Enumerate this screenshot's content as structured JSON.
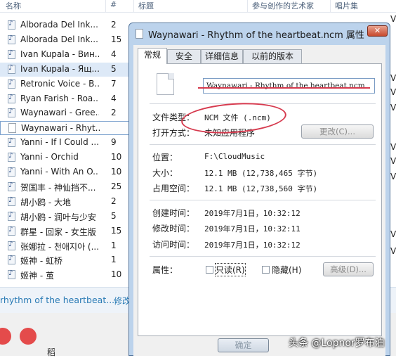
{
  "explorer": {
    "columns": {
      "name": "名称",
      "number": "#",
      "title": "标题",
      "artists": "参与创作的艺术家",
      "album": "唱片集"
    },
    "rows": [
      {
        "name": "Alborada Del Ink...",
        "num": "2"
      },
      {
        "name": "Alborada Del Ink...",
        "num": "15"
      },
      {
        "name": "Ivan Kupala - Вин...",
        "num": "4"
      },
      {
        "name": "Ivan Kupala - Ящ...",
        "num": "5"
      },
      {
        "name": "Retronic Voice - B...",
        "num": "7"
      },
      {
        "name": "Ryan Farish - Roa...",
        "num": "4"
      },
      {
        "name": "Waynawari - Gree...",
        "num": "2"
      },
      {
        "name": "Waynawari - Rhyt...",
        "num": ""
      },
      {
        "name": "Yanni - If I Could ...",
        "num": "9"
      },
      {
        "name": "Yanni - Orchid",
        "num": "10"
      },
      {
        "name": "Yanni - With An O...",
        "num": "10"
      },
      {
        "name": "贺国丰 - 神仙挡不...",
        "num": "25"
      },
      {
        "name": "胡小鸥 - 大地",
        "num": "2"
      },
      {
        "name": "胡小鸥 - 润叶与少安",
        "num": "5"
      },
      {
        "name": "群星 - 回家 - 女生版",
        "num": "15"
      },
      {
        "name": "张娜拉 - 천애지아 (...",
        "num": "1"
      },
      {
        "name": "姬神 - 虹桥",
        "num": "1"
      },
      {
        "name": "姬神 - 茧",
        "num": "10"
      }
    ],
    "right_edge": [
      "V",
      "V",
      "V",
      "V",
      "V",
      "V",
      "V",
      "V",
      "V"
    ],
    "details": {
      "title_text": "rhythm of the heartbeat....",
      "modify_text": "修改"
    },
    "bottom_char": "稻"
  },
  "dialog": {
    "title": "Waynawari - Rhythm of the heartbeat.ncm 属性",
    "close_glyph": "✕",
    "tabs": [
      "常规",
      "安全",
      "详细信息",
      "以前的版本"
    ],
    "filename": "Waynawari - Rhythm of the heartbeat.ncm",
    "file_type_label": "文件类型：",
    "file_type_value": "NCM 文件 (.ncm)",
    "open_with_label": "打开方式：",
    "open_with_value": "未知应用程序",
    "change_button": "更改(C)...",
    "location_label": "位置：",
    "location_value": "F:\\CloudMusic",
    "size_label": "大小：",
    "size_value": "12.1 MB (12,738,465 字节)",
    "size_on_disk_label": "占用空间：",
    "size_on_disk_value": "12.1 MB (12,738,560 字节)",
    "created_label": "创建时间：",
    "created_value": "2019年7月1日，10:32:12",
    "modified_label": "修改时间：",
    "modified_value": "2019年7月1日，10:32:11",
    "accessed_label": "访问时间：",
    "accessed_value": "2019年7月1日，10:32:12",
    "attributes_label": "属性：",
    "readonly_label": "只读(R)",
    "hidden_label": "隐藏(H)",
    "advanced_button": "高级(D)...",
    "ok_button": "确定"
  },
  "watermark": "头条 @Lopnor罗布泊",
  "colors": {
    "annotation": "#d63a4e",
    "dialog_frame": "#bcd3ec",
    "link_blue": "#2a7bb5"
  }
}
